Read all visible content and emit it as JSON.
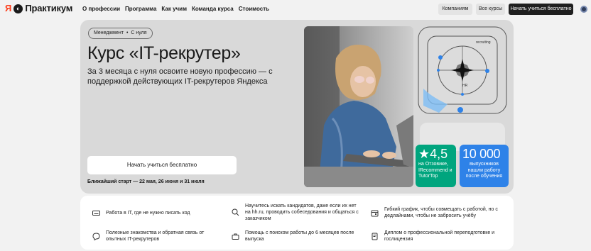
{
  "header": {
    "logo_ya": "Я",
    "logo_text": "Практикум",
    "nav": [
      "О профессии",
      "Программа",
      "Как учим",
      "Команда курса",
      "Стоимость"
    ],
    "btn_companies": "Компаниям",
    "btn_courses": "Все курсы",
    "btn_start": "Начать учиться бесплатно"
  },
  "hero": {
    "chip_category": "Менеджмент",
    "chip_sep": "•",
    "chip_level": "С нуля",
    "title": "Курс «IT-рекрутер»",
    "subtitle": "За 3 месяца с нуля освоите новую профессию — с поддержкой действующих IT-рекрутеров Яндекса",
    "cta": "Начать учиться бесплатно",
    "start_text": "Ближайший старт — 22 мая, 26 июня и 31 июля",
    "compass_label_top": "recruiting",
    "compass_label_bottom": "HR",
    "rating_value": "4,5",
    "rating_text": "на Отзовике, IRecommend и TutorTop",
    "grads_value": "10 000",
    "grads_text": "выпускников нашли работу после обучения"
  },
  "features": [
    {
      "icon": "keyboard-icon",
      "text": "Работа в IT, где не нужно писать код"
    },
    {
      "icon": "search-icon",
      "text": "Научитесь искать кандидатов, даже если их нет на hh.ru, проводить собеседования и общаться с заказчиком"
    },
    {
      "icon": "calendar-icon",
      "text": "Гибкий график, чтобы совмещать с работой, но с дедлайнами, чтобы не забросить учёбу"
    },
    {
      "icon": "chat-icon",
      "text": "Полезные знакомства и обратная связь от опытных IT-рекрутеров"
    },
    {
      "icon": "briefcase-icon",
      "text": "Помощь с поиском работы до 6 месяцев после выпуска"
    },
    {
      "icon": "diploma-icon",
      "text": "Диплом о профессиональной переподготовке и гослицензия"
    }
  ],
  "colors": {
    "brand_red": "#fc3f1d",
    "rating_green": "#00a57e",
    "grads_blue": "#2e82e8",
    "hero_bg": "#d9d9d9"
  }
}
